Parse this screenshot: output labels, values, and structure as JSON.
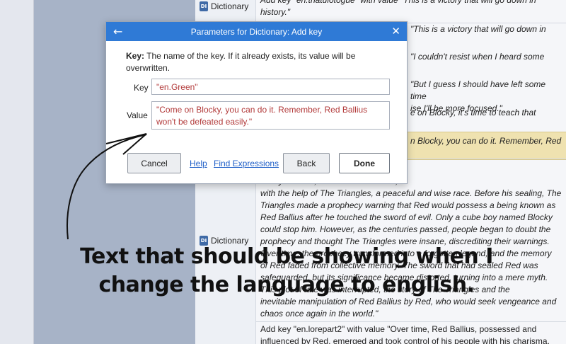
{
  "app": {
    "tag_label": "Dictionary",
    "tag_icon_text": "DI",
    "rows": [
      {
        "text": "Add key \"en.tnatulotogue\" with value \"This is a victory that will go down in\nhistory.\""
      },
      {
        "text": "\"This is a victory that will go down in"
      },
      {
        "text": "\"I couldn't resist when I heard some"
      },
      {
        "text": "\"But I guess I should have left some time\nise I'll be more focused.\""
      },
      {
        "text": "e on Blocky, it's time to teach that"
      },
      {
        "text": "n Blocky, you can do it. Remember, Red"
      },
      {
        "text": "00 years ago, Red, an evil being in the\nled by Takeshi, the last ancient hero,\nwith the help of The Triangles, a peaceful and wise race. Before his sealing, The\nTriangles made a prophecy warning that Red would possess a being known as\nRed Ballius after he touched the sword of evil. Only a cube boy named Blocky\ncould stop him. However, as the centuries passed, people began to doubt the\nprophecy and thought The Triangles were insane, discrediting their warnings.\nOver time, the prophecy transformed into a forgotten legend, and the memory\nof Red faded from collective memory. The sword that had sealed Red was\nsafeguarded, but its significance became distorted, turning into a mere myth.\nThis plot of fate was interrupted, the story of The Triangles and the\ninevitable manipulation of Red Ballius by Red, who would seek vengeance and\nchaos once again in the world.\""
      },
      {
        "text": "Add key \"en.lorepart2\" with value \"Over time, Red Ballius, possessed and\ninfluenced by Red, emerged and took control of his people with his charisma."
      }
    ]
  },
  "dialog": {
    "title": "Parameters for Dictionary: Add key",
    "back_icon": "←",
    "close_icon": "✕",
    "desc_bold": "Key:",
    "desc_text": " The name of the key. If it already exists, its value will be overwritten.",
    "key_label": "Key",
    "key_value": "\"en.Green\"",
    "value_label": "Value",
    "value_value": "\"Come on Blocky, you can do it. Remember, Red Ballius won't be defeated easily.\"",
    "cancel": "Cancel",
    "help": "Help",
    "find_expressions": "Find Expressions",
    "back": "Back",
    "done": "Done"
  },
  "caption": {
    "line1": "Text that should be showing when I",
    "line2": "change the language to english."
  }
}
